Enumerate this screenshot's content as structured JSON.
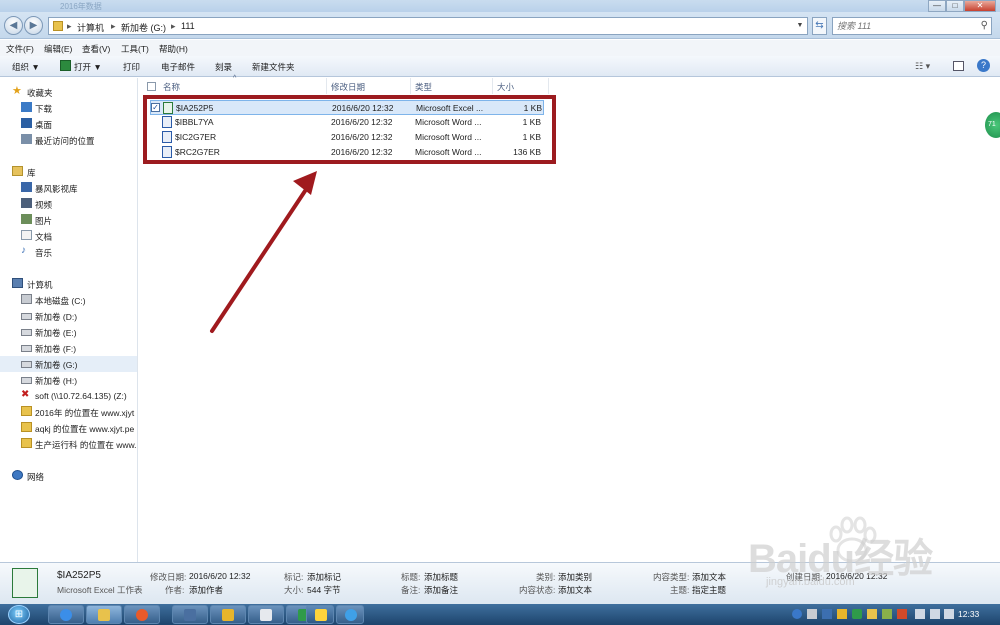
{
  "window": {
    "title": "2016年数据",
    "min": "—",
    "max": "□",
    "close": "✕"
  },
  "address": {
    "segments": [
      "计算机",
      "新加卷 (G:)",
      "111"
    ],
    "sep": "▸"
  },
  "search": {
    "placeholder": "搜索 111"
  },
  "menu": [
    "文件(F)",
    "编辑(E)",
    "查看(V)",
    "工具(T)",
    "帮助(H)"
  ],
  "toolbar": {
    "organize": "组织 ▼",
    "open": "打开 ▼",
    "print": "打印",
    "email": "电子邮件",
    "burn": "刻录",
    "new_folder": "新建文件夹"
  },
  "sidebar": {
    "favorites": "收藏夹",
    "fav_items": [
      "下载",
      "桌面",
      "最近访问的位置"
    ],
    "libraries": "库",
    "lib_items": [
      "暴风影视库",
      "视频",
      "图片",
      "文档",
      "音乐"
    ],
    "computer": "计算机",
    "drives": [
      "本地磁盘 (C:)",
      "新加卷 (D:)",
      "新加卷 (E:)",
      "新加卷 (F:)",
      "新加卷 (G:)",
      "新加卷 (H:)",
      "soft (\\\\10.72.64.135) (Z:)",
      "2016年 的位置在 www.xjyt",
      "aqkj 的位置在 www.xjyt.pe",
      "生产运行科 的位置在 www."
    ],
    "network": "网络"
  },
  "columns": {
    "name": "名称",
    "date": "修改日期",
    "type": "类型",
    "size": "大小"
  },
  "files": [
    {
      "name": "$IA252P5",
      "date": "2016/6/20 12:32",
      "type": "Microsoft Excel ...",
      "size": "1 KB",
      "icon": "excel-file-icon"
    },
    {
      "name": "$IBBL7YA",
      "date": "2016/6/20 12:32",
      "type": "Microsoft Word ...",
      "size": "1 KB",
      "icon": "word-file-icon"
    },
    {
      "name": "$IC2G7ER",
      "date": "2016/6/20 12:32",
      "type": "Microsoft Word ...",
      "size": "1 KB",
      "icon": "word-file-icon"
    },
    {
      "name": "$RC2G7ER",
      "date": "2016/6/20 12:32",
      "type": "Microsoft Word ...",
      "size": "136 KB",
      "icon": "word-file-icon"
    }
  ],
  "details": {
    "name": "$IA252P5",
    "kind": "Microsoft Excel 工作表",
    "modified_label": "修改日期:",
    "modified": "2016/6/20 12:32",
    "author_label": "作者:",
    "author": "添加作者",
    "tags_label": "标记:",
    "tags": "添加标记",
    "size_label": "大小:",
    "size": "544 字节",
    "title_label": "标题:",
    "title": "添加标题",
    "comments_label": "备注:",
    "comments": "添加备注",
    "category_label": "类别:",
    "category": "添加类别",
    "content_status_label": "内容状态:",
    "content_status": "添加文本",
    "content_type_label": "内容类型:",
    "content_type": "添加文本",
    "subject_label": "主题:",
    "subject": "指定主题",
    "created_label": "创建日期:",
    "created": "2016/6/20 12:32"
  },
  "taskbar": {
    "clock": "12:33"
  },
  "watermark": {
    "text": "Baidu经验",
    "sub": "jingyan.baidu.com"
  },
  "float_badge": "71",
  "colors": {
    "highlight": "#9c1b1f",
    "arrow": "#a01a1e"
  }
}
